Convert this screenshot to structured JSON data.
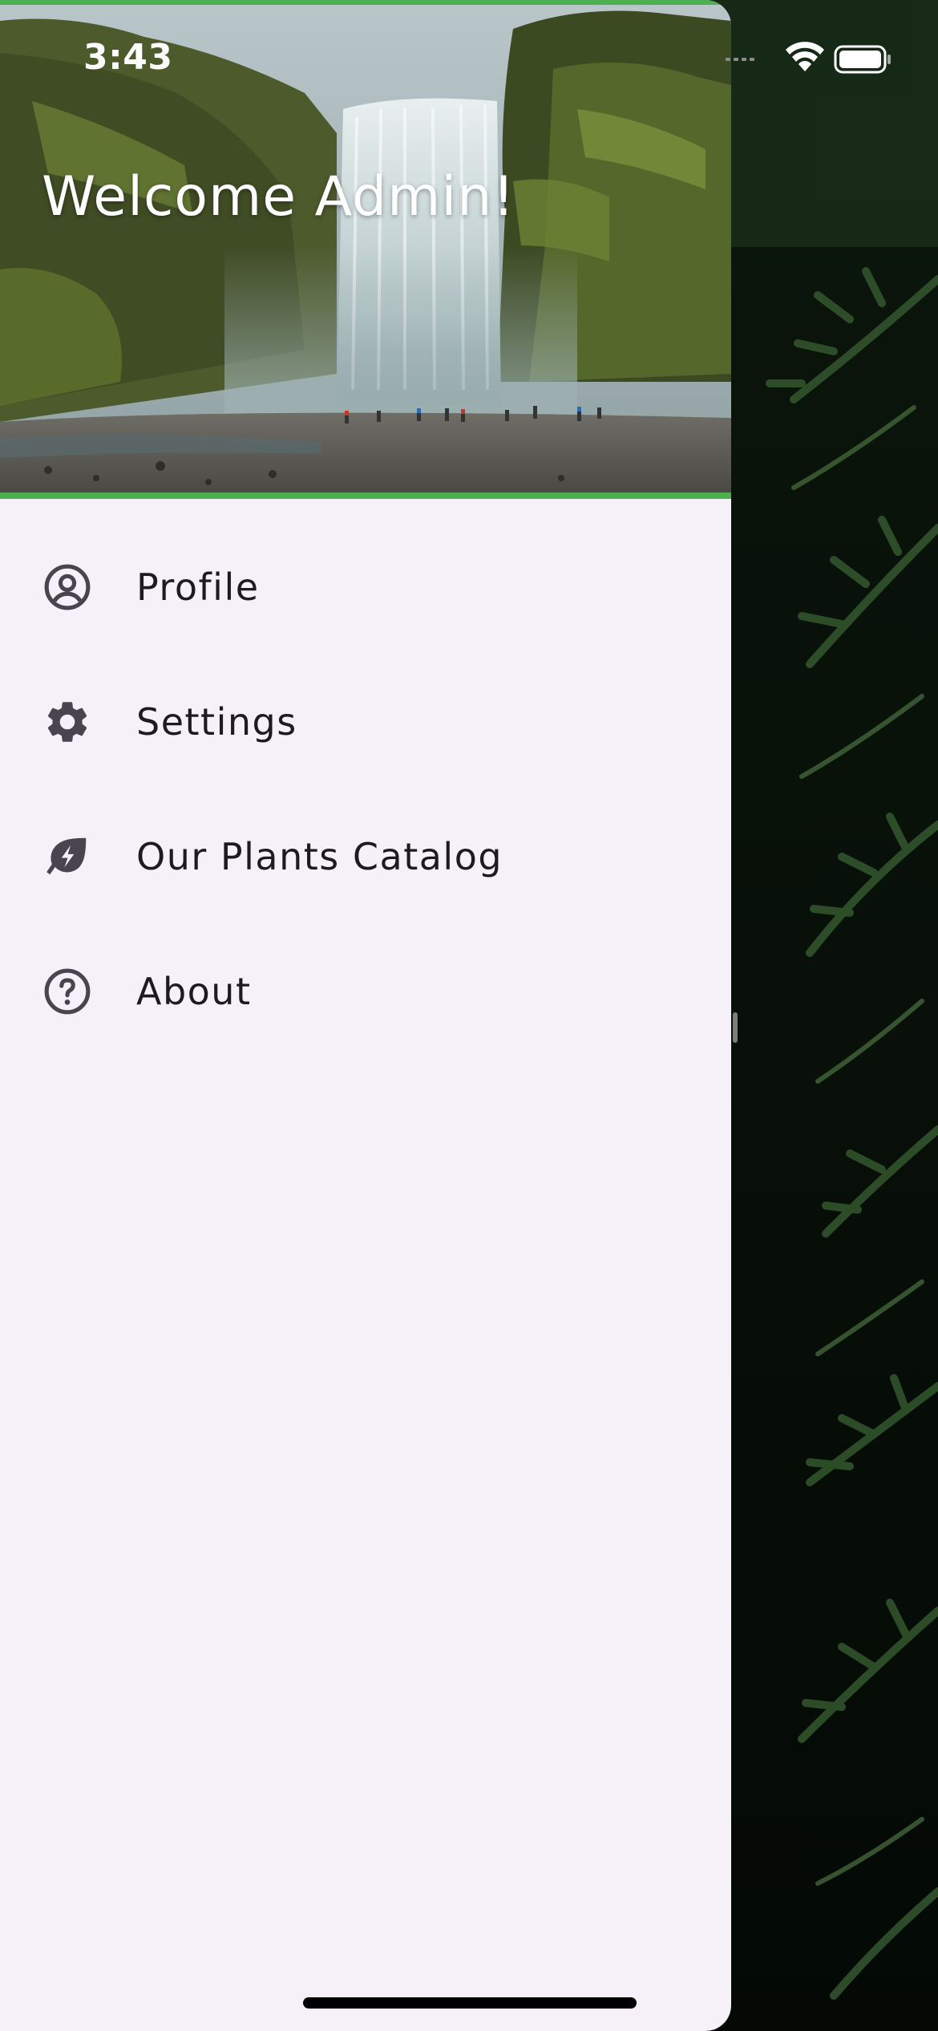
{
  "status_bar": {
    "time": "3:43"
  },
  "drawer": {
    "header": {
      "title": "Welcome Admin!"
    },
    "items": [
      {
        "label": "Profile",
        "icon": "account-circle-icon"
      },
      {
        "label": "Settings",
        "icon": "gear-icon"
      },
      {
        "label": "Our Plants Catalog",
        "icon": "eco-leaf-bolt-icon"
      },
      {
        "label": "About",
        "icon": "help-circle-icon"
      }
    ]
  },
  "colors": {
    "accent_green": "#4caf50",
    "app_bar": "#1c331d",
    "drawer_background": "#f6f1f8",
    "icon_color": "#49454f",
    "text_color": "#1d1b20"
  }
}
